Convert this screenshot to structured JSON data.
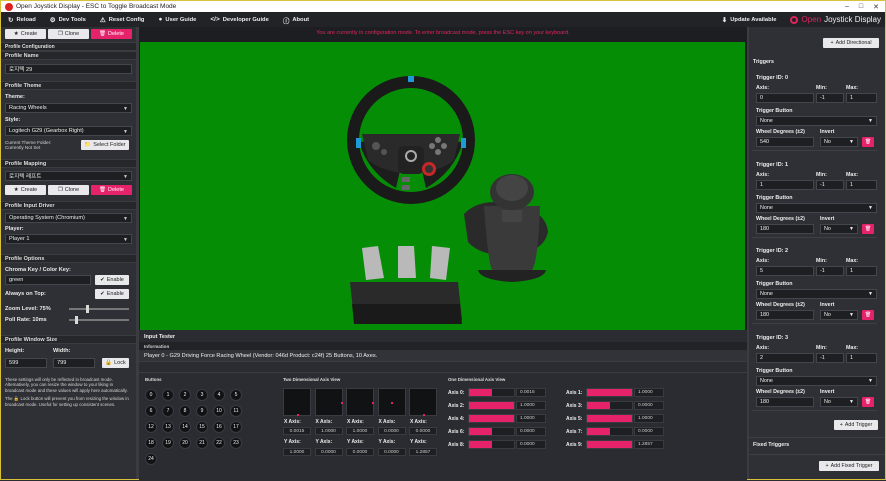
{
  "window": {
    "title": "Open Joystick Display - ESC to Toggle Broadcast Mode"
  },
  "menu": {
    "reload": "Reload",
    "dev_tools": "Dev Tools",
    "reset_config": "Reset Config",
    "user_guide": "User Guide",
    "developer_guide": "Developer Guide",
    "about": "About",
    "update_available": "Update Available",
    "brand_open": "Open",
    "brand_rest": "Joystick Display"
  },
  "profile": {
    "create": "Create",
    "clone": "Clone",
    "delete": "Delete",
    "configuration_title": "Profile Configuration",
    "name_title": "Profile Name",
    "name_value": "로지텍 29",
    "theme_section": "Profile Theme",
    "theme_label": "Theme:",
    "theme_value": "Racing Wheels",
    "style_label": "Style:",
    "style_value": "Logitech G29 (Gearbox Right)",
    "folder_label": "Current Theme Folder:",
    "folder_value": "Currently Not Set",
    "select_folder": "Select Folder",
    "mapping_section": "Profile Mapping",
    "mapping_value": "로지텍 레프트",
    "map_create": "Create",
    "map_clone": "Clone",
    "map_delete": "Delete",
    "input_driver_section": "Profile Input Driver",
    "driver_value": "Operating System (Chromium)",
    "player_label": "Player:",
    "player_value": "Player 1",
    "options_section": "Profile Options",
    "chroma_label": "Chroma Key / Color Key:",
    "chroma_value": "green",
    "chroma_enable": "Enable",
    "always_on_top_label": "Always on Top:",
    "always_on_top_enable": "Enable",
    "zoom_label": "Zoom Level: 75%",
    "zoom": 0.3,
    "poll_label": "Poll Rate: 10ms",
    "poll": 0.1,
    "window_size_section": "Profile Window Size",
    "height_label": "Height:",
    "height_value": "599",
    "width_label": "Width:",
    "width_value": "799",
    "lock": "Lock",
    "note1": "These settings will only be reflected in broadcast mode. Alternatively, you can resize the window to your liking in broadcast mode and these values will apply here automatically.",
    "note2": "The 🔒 Lock button will prevent you from resizing the window in broadcast mode. Useful for setting up consistent scenes."
  },
  "stage": {
    "config_message": "You are currently in configuration mode. To enter broadcast mode, press the ESC key on your keyboard.",
    "background_color": "#068d06"
  },
  "tester": {
    "title": "Input Tester",
    "info_title": "Information",
    "info_text": "Player 0 - G29 Driving Force Racing Wheel (Vendor: 046d Product: c24f) 25 Buttons, 10 Axes.",
    "buttons_title": "Buttons",
    "buttons": [
      "0",
      "1",
      "2",
      "3",
      "4",
      "5",
      "6",
      "7",
      "8",
      "9",
      "10",
      "11",
      "12",
      "13",
      "14",
      "15",
      "16",
      "17",
      "18",
      "19",
      "20",
      "21",
      "22",
      "23",
      "24"
    ],
    "two_d_title": "Two Dimensional Axis View",
    "two_d": [
      {
        "x_label": "X Axis:",
        "x": "0.0015",
        "y_label": "Y Axis:",
        "y": "1.0000"
      },
      {
        "x_label": "X Axis:",
        "x": "1.0000",
        "y_label": "Y Axis:",
        "y": "0.0000"
      },
      {
        "x_label": "X Axis:",
        "x": "1.0000",
        "y_label": "Y Axis:",
        "y": "0.0000"
      },
      {
        "x_label": "X Axis:",
        "x": "0.0000",
        "y_label": "Y Axis:",
        "y": "0.0000"
      },
      {
        "x_label": "X Axis:",
        "x": "0.0000",
        "y_label": "Y Axis:",
        "y": "1.2857"
      }
    ],
    "one_d_title": "One Dimensional Axis View",
    "one_d": [
      {
        "label": "Axis 0:",
        "value": "0.0015",
        "fill": 0.5
      },
      {
        "label": "Axis 1:",
        "value": "1.0000",
        "fill": 1.0
      },
      {
        "label": "Axis 2:",
        "value": "1.0000",
        "fill": 1.0
      },
      {
        "label": "Axis 3:",
        "value": "0.0000",
        "fill": 0.5
      },
      {
        "label": "Axis 4:",
        "value": "1.0000",
        "fill": 1.0
      },
      {
        "label": "Axis 5:",
        "value": "1.0000",
        "fill": 1.0
      },
      {
        "label": "Axis 6:",
        "value": "0.0000",
        "fill": 0.5
      },
      {
        "label": "Axis 7:",
        "value": "0.0000",
        "fill": 0.5
      },
      {
        "label": "Axis 8:",
        "value": "0.0000",
        "fill": 0.5
      },
      {
        "label": "Axis 9:",
        "value": "1.2857",
        "fill": 1.0
      }
    ]
  },
  "triggers": {
    "add_directional": "Add Directional",
    "title": "Triggers",
    "axis_label": "Axis:",
    "min_label": "Min:",
    "max_label": "Max:",
    "button_label": "Trigger Button",
    "wheel_label": "Wheel Degrees (±2)",
    "invert_label": "Invert",
    "items": [
      {
        "id": "Trigger ID: 0",
        "axis": "0",
        "min": "-1",
        "max": "1",
        "button": "None",
        "degrees": "540",
        "invert": "No"
      },
      {
        "id": "Trigger ID: 1",
        "axis": "1",
        "min": "-1",
        "max": "1",
        "button": "None",
        "degrees": "180",
        "invert": "No"
      },
      {
        "id": "Trigger ID: 2",
        "axis": "5",
        "min": "-1",
        "max": "1",
        "button": "None",
        "degrees": "180",
        "invert": "No"
      },
      {
        "id": "Trigger ID: 3",
        "axis": "2",
        "min": "-1",
        "max": "1",
        "button": "None",
        "degrees": "180",
        "invert": "No"
      }
    ],
    "add_trigger": "Add Trigger",
    "fixed_title": "Fixed Triggers",
    "add_fixed": "Add Fixed Trigger"
  }
}
